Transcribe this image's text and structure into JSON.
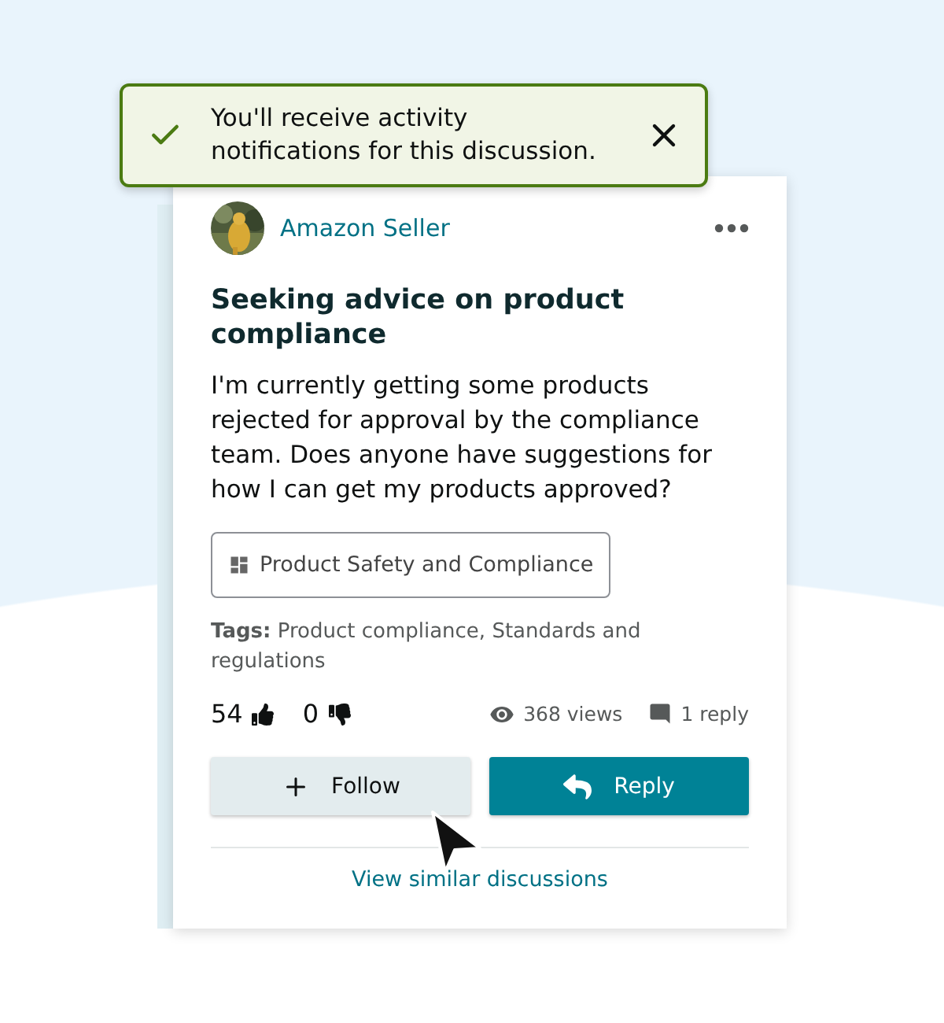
{
  "toast": {
    "message": "You'll receive activity notifications for this discussion."
  },
  "post": {
    "author": "Amazon Seller",
    "title": "Seeking advice on product compliance",
    "body": "I'm currently getting some products rejected for approval by the compliance team. Does anyone have suggestions for how I can get my products approved?",
    "category": "Product Safety and Compliance",
    "tags": "**Tags:** Product compliance, Standards and regulations",
    "likes": "54",
    "dislikes": "0",
    "views": "368 views",
    "replies": "1 reply"
  },
  "buttons": [
    {
      "kind": "follow",
      "label": "Follow"
    },
    {
      "kind": "reply",
      "label": "Reply"
    }
  ],
  "link": "View similar discussions"
}
